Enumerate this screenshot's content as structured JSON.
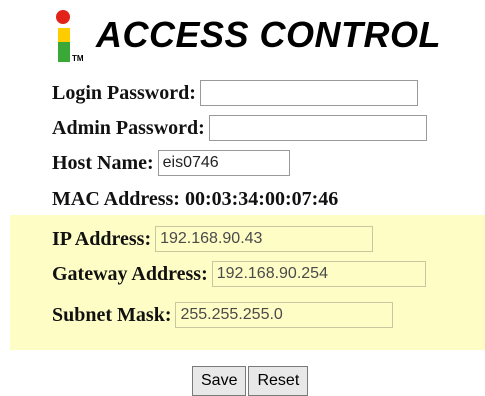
{
  "header": {
    "title": "ACCESS CONTROL",
    "logo_tm": "TM",
    "logo_colors": {
      "dot": "#e2231a",
      "bar_top": "#ffcc00",
      "bar_bottom": "#3aa836"
    }
  },
  "form": {
    "login_password": {
      "label": "Login Password:",
      "value": ""
    },
    "admin_password": {
      "label": "Admin Password:",
      "value": ""
    },
    "host_name": {
      "label": "Host Name:",
      "value": "eis0746"
    },
    "mac_address": {
      "label": "MAC Address: 00:03:34:00:07:46"
    }
  },
  "network": {
    "ip_address": {
      "label": "IP Address:",
      "value": "192.168.90.43"
    },
    "gateway_address": {
      "label": "Gateway Address:",
      "value": "192.168.90.254"
    },
    "subnet_mask": {
      "label": "Subnet Mask:",
      "value": "255.255.255.0"
    },
    "background": "#fefdc5"
  },
  "buttons": {
    "save": "Save",
    "reset": "Reset"
  }
}
